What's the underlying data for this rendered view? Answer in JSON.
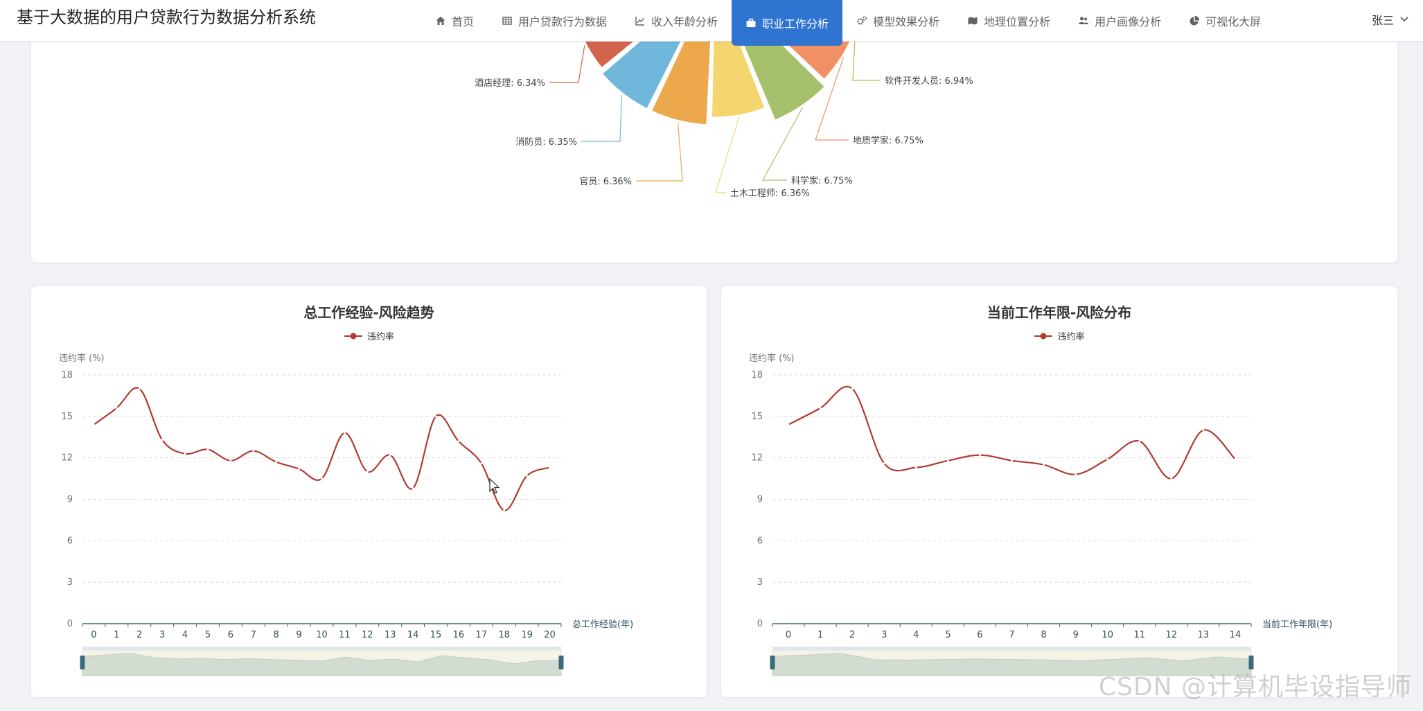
{
  "app": {
    "title": "基于大数据的用户贷款行为数据分析系统",
    "user": "张三"
  },
  "nav": [
    {
      "label": "首页",
      "icon": "home-icon",
      "active": false
    },
    {
      "label": "用户贷款行为数据",
      "icon": "table-icon",
      "active": false
    },
    {
      "label": "收入年龄分析",
      "icon": "line-chart-icon",
      "active": false
    },
    {
      "label": "职业工作分析",
      "icon": "briefcase-icon",
      "active": true
    },
    {
      "label": "模型效果分析",
      "icon": "gears-icon",
      "active": false
    },
    {
      "label": "地理位置分析",
      "icon": "map-icon",
      "active": false
    },
    {
      "label": "用户画像分析",
      "icon": "users-icon",
      "active": false
    },
    {
      "label": "可视化大屏",
      "icon": "pie-icon",
      "active": false
    }
  ],
  "colors": {
    "accent": "#2f74d0",
    "line": "#b03a2e"
  },
  "chart_data": [
    {
      "type": "pie",
      "variant": "rose",
      "slices": [
        {
          "label": "酒店经理",
          "value": 6.34,
          "color": "#d2644b"
        },
        {
          "label": "消防员",
          "value": 6.35,
          "color": "#70b7dc"
        },
        {
          "label": "官员",
          "value": 6.36,
          "color": "#eca84a"
        },
        {
          "label": "土木工程师",
          "value": 6.36,
          "color": "#f5d56d"
        },
        {
          "label": "科学家",
          "value": 6.75,
          "color": "#a6c16b"
        },
        {
          "label": "地质学家",
          "value": 6.75,
          "color": "#f38f64"
        },
        {
          "label": "软件开发人员",
          "value": 6.94,
          "color": "#b8ba44"
        }
      ],
      "label_texts": [
        "酒店经理: 6.34%",
        "消防员: 6.35%",
        "官员: 6.36%",
        "土木工程师: 6.36%",
        "科学家: 6.75%",
        "地质学家: 6.75%",
        "软件开发人员: 6.94%"
      ]
    },
    {
      "type": "line",
      "title": "总工作经验-风险趋势",
      "series": [
        {
          "name": "违约率",
          "values": [
            14.4,
            15.6,
            17.0,
            13.3,
            12.3,
            12.6,
            11.8,
            12.5,
            11.7,
            11.2,
            10.5,
            13.8,
            11.0,
            12.2,
            9.8,
            15.0,
            13.2,
            11.6,
            8.2,
            10.7,
            11.3
          ]
        }
      ],
      "categories": [
        "0",
        "1",
        "2",
        "3",
        "4",
        "5",
        "6",
        "7",
        "8",
        "9",
        "10",
        "11",
        "12",
        "13",
        "14",
        "15",
        "16",
        "17",
        "18",
        "19",
        "20"
      ],
      "ylabel": "违约率 (%)",
      "xlabel": "总工作经验(年)",
      "ylim": [
        0,
        18
      ],
      "yticks": [
        "0",
        "3",
        "6",
        "9",
        "12",
        "15",
        "18"
      ],
      "grid": true,
      "legend": "top-center",
      "data_zoom": true
    },
    {
      "type": "line",
      "title": "当前工作年限-风险分布",
      "series": [
        {
          "name": "违约率",
          "values": [
            14.4,
            15.6,
            17.0,
            11.6,
            11.3,
            11.8,
            12.2,
            11.8,
            11.5,
            10.8,
            11.9,
            13.2,
            10.5,
            14.0,
            11.9
          ]
        }
      ],
      "categories": [
        "0",
        "1",
        "2",
        "3",
        "4",
        "5",
        "6",
        "7",
        "8",
        "9",
        "10",
        "11",
        "12",
        "13",
        "14"
      ],
      "ylabel": "违约率 (%)",
      "xlabel": "当前工作年限(年)",
      "ylim": [
        0,
        18
      ],
      "yticks": [
        "0",
        "3",
        "6",
        "9",
        "12",
        "15",
        "18"
      ],
      "grid": true,
      "legend": "top-center",
      "data_zoom": true
    }
  ],
  "watermark": "CSDN @计算机毕设指导师"
}
